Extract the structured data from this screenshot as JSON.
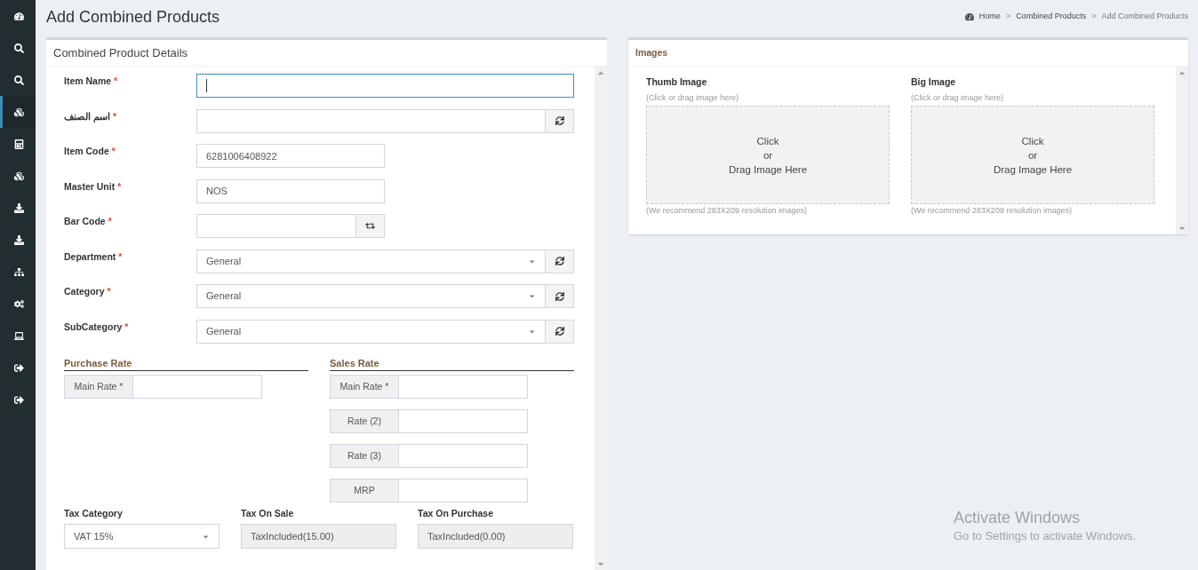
{
  "sidebar": {
    "items": [
      {
        "selected": false
      },
      {
        "selected": false
      },
      {
        "selected": false
      },
      {
        "selected": true
      },
      {
        "selected": false
      },
      {
        "selected": false
      },
      {
        "selected": false
      },
      {
        "selected": false
      },
      {
        "selected": false
      },
      {
        "selected": false
      },
      {
        "selected": false
      },
      {
        "selected": false
      },
      {
        "selected": false
      }
    ]
  },
  "page_title": "Add Combined Products",
  "breadcrumb": [
    {
      "label": "Home"
    },
    {
      "separator": ">",
      "label": "Combined Products"
    },
    {
      "separator": ">",
      "label": "Add Combined Products"
    }
  ],
  "details_panel": {
    "title": "Combined Product Details",
    "fields": [
      {
        "label": "Item Name",
        "mark": "*",
        "kind": "wide",
        "focused": true
      },
      {
        "label": "اسم الصنف",
        "mark": "*",
        "kind": "wide-refresh",
        "focused": false
      },
      {
        "label": "Item Code",
        "mark": "*",
        "kind": "short",
        "value": "6281006408922",
        "focused": false
      },
      {
        "label": "Master Unit",
        "mark": "*",
        "kind": "short",
        "value": "NOS",
        "focused": false
      },
      {
        "label": "Bar Code",
        "mark": "*",
        "kind": "short-button",
        "focused": false
      },
      {
        "label": "Department",
        "mark": "*",
        "kind": "select-refresh",
        "value": "General",
        "focused": false
      },
      {
        "label": "Category",
        "mark": "*",
        "kind": "select-refresh",
        "value": "General",
        "focused": false
      },
      {
        "label": "SubCategory",
        "mark": "*",
        "kind": "select-refresh",
        "value": "General",
        "focused": false
      }
    ],
    "purchase_rate": {
      "title": "Purchase Rate",
      "rows": [
        {
          "label": "Main Rate *"
        }
      ]
    },
    "sales_rate": {
      "title": "Sales Rate",
      "rows": [
        {
          "label": "Main Rate *"
        },
        {
          "label": "Rate (2)"
        },
        {
          "label": "Rate (3)"
        },
        {
          "label": "MRP"
        }
      ]
    },
    "tax_fields": [
      {
        "label": "Tax Category",
        "kind": "select",
        "value": "VAT 15%"
      },
      {
        "label": "Tax On Sale",
        "kind": "readonly",
        "value": "TaxIncluded(15.00)"
      },
      {
        "label": "Tax On Purchase",
        "kind": "readonly",
        "value": "TaxIncluded(0.00)"
      }
    ]
  },
  "images_panel": {
    "title": "Images",
    "uploads": [
      {
        "title": "Thumb Image",
        "hint": "(Click or drag image here)",
        "drop_lines": [
          "Click",
          "or",
          "Drag Image Here"
        ],
        "note": "(We recommend 283X209 resolution images)"
      },
      {
        "title": "Big Image",
        "hint": "(Click or drag image here)",
        "drop_lines": [
          "Click",
          "or",
          "Drag Image Here"
        ],
        "note": "(We recommend 283X209 resolution images)"
      }
    ]
  },
  "os_notice": {
    "title": "Activate Windows",
    "text": "Go to Settings to activate Windows."
  }
}
